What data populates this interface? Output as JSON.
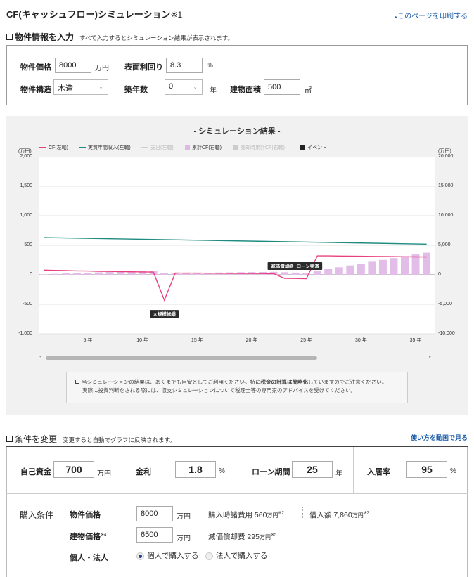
{
  "header": {
    "title": "CF(キャッシュフロー)シミュレーション",
    "title_note": "※1",
    "print_link": "このページを印刷する"
  },
  "property_section": {
    "heading": "物件情報を入力",
    "subtext": "すべて入力するとシミュレーション結果が表示されます。",
    "price": {
      "label": "物件価格",
      "value": "8000",
      "unit": "万円"
    },
    "yield": {
      "label": "表面利回り",
      "value": "8.3",
      "unit": "%"
    },
    "structure": {
      "label": "物件構造",
      "value": "木造"
    },
    "age": {
      "label": "築年数",
      "value": "0",
      "unit": "年"
    },
    "area": {
      "label": "建物面積",
      "value": "500",
      "unit": "㎡"
    }
  },
  "simulation": {
    "title": "- シミュレーション結果 -",
    "disclaimer_line1_a": "当シミュレーションの結果は、あくまでも目安としてご利用ください。特に",
    "disclaimer_line1_bold": "税金の計算は簡略化",
    "disclaimer_line1_b": "していますのでご注意ください。",
    "disclaimer_line2": "実際に投資判断をされる際には、収支シミュレーションについて税理士等の専門家のアドバイスを受けてください。"
  },
  "chart_data": {
    "type": "line",
    "legend": [
      {
        "name": "CF(左軸)",
        "color": "#e8407f",
        "kind": "line",
        "active": true
      },
      {
        "name": "実質年間収入(左軸)",
        "color": "#1f8a80",
        "kind": "line",
        "active": true
      },
      {
        "name": "支出(左軸)",
        "color": "#cfcfcf",
        "kind": "line",
        "active": false
      },
      {
        "name": "累計CF(右軸)",
        "color": "#e0b8e6",
        "kind": "square",
        "active": true
      },
      {
        "name": "売却時累計CF(右軸)",
        "color": "#cccccc",
        "kind": "square",
        "active": false
      },
      {
        "name": "イベント",
        "color": "#222222",
        "kind": "square",
        "active": true
      }
    ],
    "left_unit": "(万円)",
    "right_unit": "(万円)",
    "y_left_ticks": [
      "2,000",
      "1,500",
      "1,000",
      "500",
      "0",
      "-500",
      "-1,000"
    ],
    "y_right_ticks": [
      "20,000",
      "15,000",
      "10,000",
      "5,000",
      "0",
      "-5,000",
      "-10,000"
    ],
    "ylim_left": [
      -1000,
      2000
    ],
    "ylim_right": [
      -10000,
      20000
    ],
    "x_tick_labels": [
      "5 年",
      "10 年",
      "15 年",
      "20 年",
      "25 年",
      "30 年",
      "35 年"
    ],
    "x_tick_values": [
      5,
      10,
      15,
      20,
      25,
      30,
      35
    ],
    "x_range": [
      0.5,
      36.8
    ],
    "series": [
      {
        "name": "CF(左軸)",
        "x": [
          1,
          2,
          3,
          4,
          5,
          6,
          7,
          8,
          9,
          10,
          11,
          12,
          13,
          14,
          15,
          16,
          17,
          18,
          19,
          20,
          21,
          22,
          23,
          24,
          25,
          26,
          27,
          28,
          29,
          30,
          31,
          32,
          33,
          34,
          35,
          36
        ],
        "values": [
          80,
          75,
          71,
          67,
          64,
          60,
          57,
          54,
          51,
          49,
          47,
          -430,
          30,
          29,
          28,
          27,
          26,
          25,
          24,
          23,
          22,
          20,
          -60,
          -62,
          -65,
          320,
          320,
          318,
          316,
          314,
          312,
          310,
          308,
          306,
          304,
          302
        ]
      },
      {
        "name": "実質年間収入(左軸)",
        "x": [
          1,
          36
        ],
        "values": [
          630,
          520
        ]
      },
      {
        "name": "累計CF(右軸)",
        "x": [
          1,
          2,
          3,
          4,
          5,
          6,
          7,
          8,
          9,
          10,
          11,
          12,
          13,
          14,
          15,
          16,
          17,
          18,
          19,
          20,
          21,
          22,
          23,
          24,
          25,
          26,
          27,
          28,
          29,
          30,
          31,
          32,
          33,
          34,
          35,
          36
        ],
        "values": [
          80,
          155,
          226,
          293,
          357,
          417,
          474,
          528,
          579,
          628,
          675,
          245,
          275,
          304,
          332,
          359,
          385,
          410,
          434,
          457,
          479,
          499,
          439,
          377,
          312,
          632,
          952,
          1270,
          1586,
          1900,
          2212,
          2522,
          2830,
          3136,
          3440,
          3742
        ]
      }
    ],
    "events": [
      {
        "label": "大規模修繕",
        "x": 12,
        "value": -430,
        "position": "below"
      },
      {
        "label": "減価償却終了",
        "x": 23,
        "value": 0,
        "position": "above"
      },
      {
        "label": "ローン完済",
        "x": 25,
        "value": 0,
        "position": "above"
      }
    ]
  },
  "conditions": {
    "heading": "条件を変更",
    "subtext": "変更すると自動でグラフに反映されます。",
    "video_link": "使い方を動画で見る",
    "own_funds": {
      "label": "自己資金",
      "value": "700",
      "unit": "万円"
    },
    "interest": {
      "label": "金利",
      "value": "1.8",
      "unit": "%"
    },
    "loan_term": {
      "label": "ローン期間",
      "value": "25",
      "unit": "年"
    },
    "occupancy": {
      "label": "入居率",
      "value": "95",
      "unit": "%"
    },
    "purchase": {
      "section_label": "購入条件",
      "price_label": "物件価格",
      "price_value": "8000",
      "price_unit": "万円",
      "misc_cost_label": "購入時諸費用",
      "misc_cost_value": "560",
      "misc_cost_unit": "万円",
      "misc_cost_note": "※2",
      "loan_amount_label": "借入額",
      "loan_amount_value": "7,860",
      "loan_amount_unit": "万円",
      "loan_amount_note": "※3",
      "building_price_label": "建物価格",
      "building_price_note": "※4",
      "building_price_value": "6500",
      "building_price_unit": "万円",
      "depreciation_label": "減価償却費",
      "depreciation_value": "295",
      "depreciation_unit": "万円",
      "depreciation_note": "※5",
      "owner_label": "個人・法人",
      "owner_options": [
        "個人で購入する",
        "法人で購入する"
      ],
      "owner_selected": 0
    }
  }
}
